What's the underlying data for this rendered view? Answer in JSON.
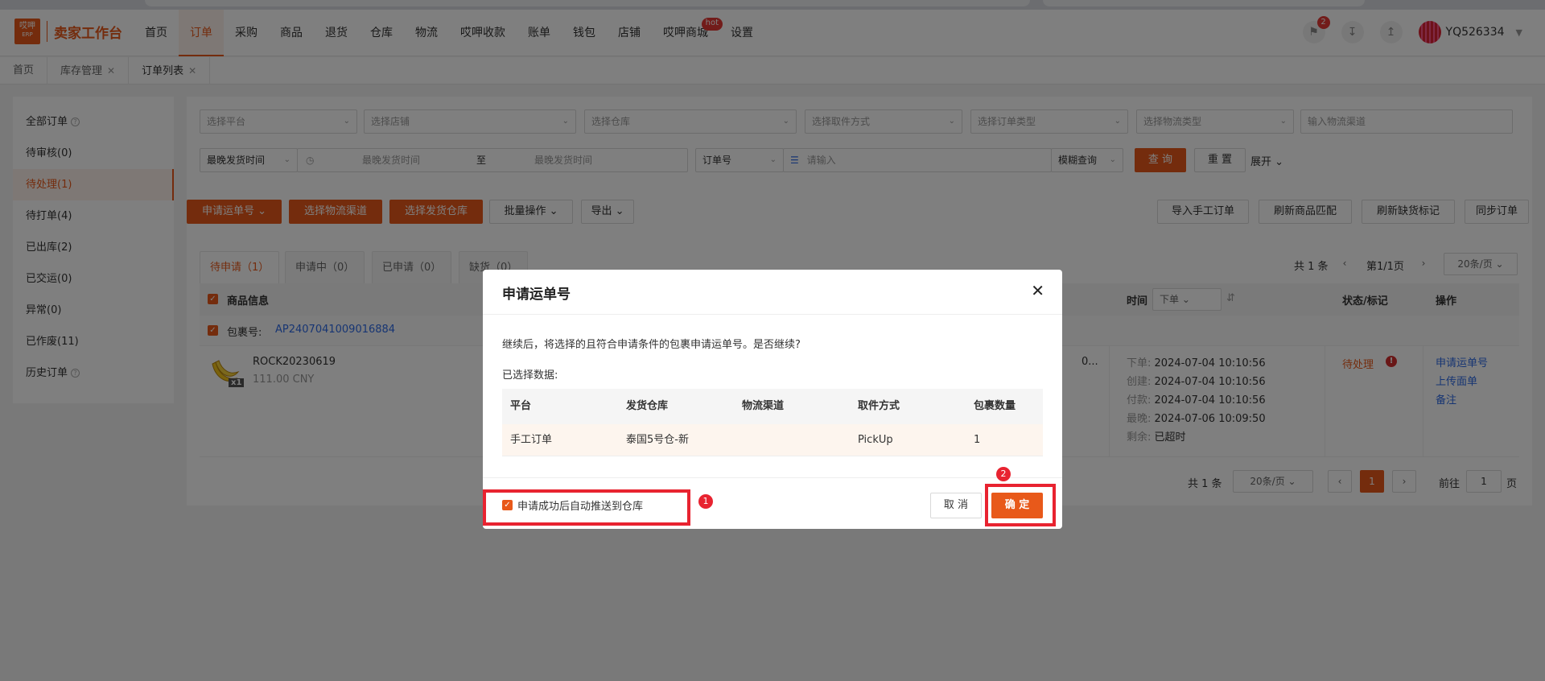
{
  "topnav": {
    "logo_top": "哎呷",
    "logo_bottom": "ERP",
    "logo_text": "卖家工作台",
    "items": [
      "首页",
      "订单",
      "采购",
      "商品",
      "退货",
      "仓库",
      "物流",
      "哎呷收款",
      "账单",
      "钱包",
      "店铺",
      "哎呷商城",
      "设置"
    ],
    "active_index": 1,
    "hot_badge": "hot",
    "notification_count": "2",
    "username": "YQ526334"
  },
  "tabs": {
    "items": [
      {
        "label": "首页",
        "closable": false
      },
      {
        "label": "库存管理",
        "closable": true
      },
      {
        "label": "订单列表",
        "closable": true
      }
    ]
  },
  "left_menu": {
    "items": [
      "全部订单",
      "待审核(0)",
      "待处理(1)",
      "待打单(4)",
      "已出库(2)",
      "已交运(0)",
      "异常(0)",
      "已作废(11)",
      "历史订单"
    ],
    "active_index": 2
  },
  "filters": {
    "platform": "选择平台",
    "shop": "选择店铺",
    "warehouse": "选择仓库",
    "pickup": "选择取件方式",
    "order_type": "选择订单类型",
    "logistics_type": "选择物流类型",
    "logistics_channel": "输入物流渠道",
    "time_select": "最晚发货时间",
    "time_start": "最晚发货时间",
    "time_to": "至",
    "time_end": "最晚发货时间",
    "order_no_select": "订单号",
    "search_placeholder": "请输入",
    "fuzzy": "模糊查询",
    "query": "查 询",
    "reset": "重 置",
    "expand": "展开"
  },
  "actions": {
    "apply_waybill": "申请运单号",
    "select_channel": "选择物流渠道",
    "select_warehouse": "选择发货仓库",
    "batch": "批量操作",
    "export": "导出",
    "import_manual": "导入手工订单",
    "refresh_match": "刷新商品匹配",
    "refresh_shortage": "刷新缺货标记",
    "sync": "同步订单"
  },
  "subtabs": [
    "待申请（1）",
    "申请中（0）",
    "已申请（0）",
    "缺货（0）"
  ],
  "pager_top": {
    "total": "共 1 条",
    "page": "第1/1页",
    "page_size": "20条/页"
  },
  "table": {
    "col_product": "商品信息",
    "col_time": "时间",
    "time_sort": "下单",
    "col_status": "状态/标记",
    "col_ops": "操作",
    "package_label": "包裹号:",
    "package_no": "AP2407041009016884",
    "product_sku": "ROCK20230619",
    "product_price": "111.00 CNY",
    "qty": "x1",
    "truncated": "0...",
    "times": [
      {
        "label": "下单:",
        "value": "2024-07-04 10:10:56"
      },
      {
        "label": "创建:",
        "value": "2024-07-04 10:10:56"
      },
      {
        "label": "付款:",
        "value": "2024-07-04 10:10:56"
      },
      {
        "label": "最晚:",
        "value": "2024-07-06 10:09:50"
      },
      {
        "label": "剩余:",
        "value": "已超时"
      }
    ],
    "status": "待处理",
    "ops": [
      "申请运单号",
      "上传面单",
      "备注"
    ]
  },
  "pager_bottom": {
    "total": "共 1 条",
    "page_size": "20条/页",
    "current": "1",
    "goto_label": "前往",
    "goto_value": "1",
    "page_suffix": "页"
  },
  "modal": {
    "title": "申请运单号",
    "message": "继续后，将选择的且符合申请条件的包裹申请运单号。是否继续?",
    "selected_label": "已选择数据:",
    "headers": [
      "平台",
      "发货仓库",
      "物流渠道",
      "取件方式",
      "包裹数量"
    ],
    "rows": [
      [
        "手工订单",
        "泰国5号仓-新",
        "",
        "PickUp",
        "1"
      ]
    ],
    "auto_push": "申请成功后自动推送到仓库",
    "cancel": "取 消",
    "confirm": "确 定"
  },
  "annotations": [
    "1",
    "2"
  ],
  "colors": {
    "accent": "#e8591a",
    "link": "#2e6be6",
    "highlight": "#e82330"
  }
}
